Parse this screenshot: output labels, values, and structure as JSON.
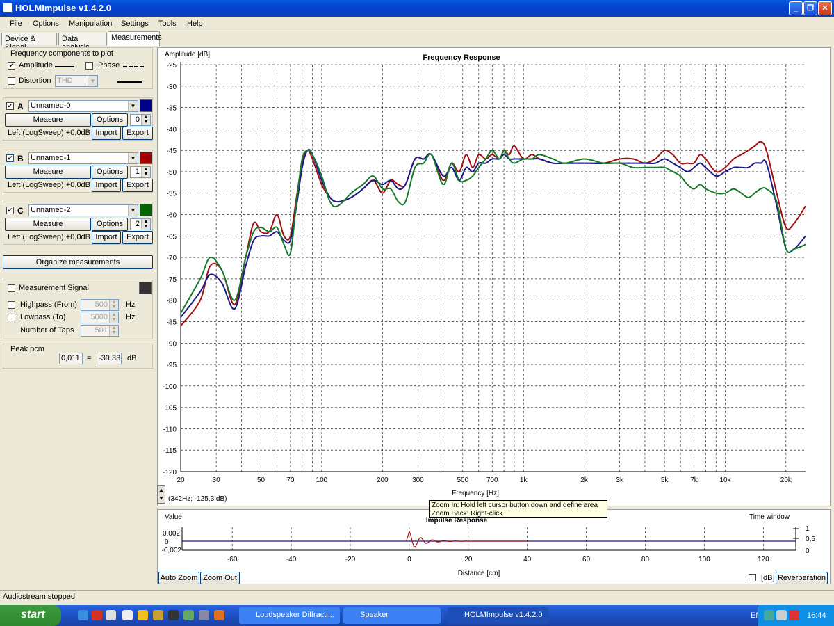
{
  "window": {
    "title": "HOLMImpulse  v1.4.2.0"
  },
  "menu": [
    "File",
    "Options",
    "Manipulation",
    "Settings",
    "Tools",
    "Help"
  ],
  "tabs": [
    "Device & Signal",
    "Data analysis",
    "Measurements"
  ],
  "freq_components": {
    "title": "Frequency components to plot",
    "amplitude_label": "Amplitude",
    "amplitude_checked": true,
    "phase_label": "Phase",
    "phase_checked": false,
    "distortion_label": "Distortion",
    "distortion_checked": false,
    "distortion_value": "THD"
  },
  "measurements": [
    {
      "letter": "A",
      "name": "Unnamed-0",
      "color": "#00008b",
      "checked": true,
      "measure_label": "Measure",
      "options_label": "Options",
      "spin": "0",
      "info": "Left (LogSweep) +0,0dB",
      "import_label": "Import",
      "export_label": "Export"
    },
    {
      "letter": "B",
      "name": "Unnamed-1",
      "color": "#a00000",
      "checked": true,
      "measure_label": "Measure",
      "options_label": "Options",
      "spin": "1",
      "info": "Left (LogSweep) +0,0dB",
      "import_label": "Import",
      "export_label": "Export"
    },
    {
      "letter": "C",
      "name": "Unnamed-2",
      "color": "#006400",
      "checked": true,
      "measure_label": "Measure",
      "options_label": "Options",
      "spin": "2",
      "info": "Left (LogSweep) +0,0dB",
      "import_label": "Import",
      "export_label": "Export"
    }
  ],
  "organize_label": "Organize measurements",
  "signal": {
    "measurement_signal_label": "Measurement Signal",
    "measurement_signal_checked": false,
    "signal_color": "#333333",
    "highpass_label": "Highpass (From)",
    "highpass_value": "500",
    "lowpass_label": "Lowpass (To)",
    "lowpass_value": "5000",
    "hz": "Hz",
    "taps_label": "Number of Taps",
    "taps_value": "501"
  },
  "peak": {
    "title": "Peak pcm",
    "value": "0,011",
    "eq": "=",
    "db_value": "-39,33",
    "unit": "dB"
  },
  "chart_data": {
    "type": "line",
    "title": "Frequency Response",
    "ylabel": "Amplitude [dB]",
    "xlabel": "Frequency [Hz]",
    "xscale": "log",
    "xlim": [
      20,
      25000
    ],
    "ylim": [
      -120,
      -25
    ],
    "yticks": [
      "-25",
      "-30",
      "-35",
      "-40",
      "-45",
      "-50",
      "-55",
      "-60",
      "-65",
      "-70",
      "-75",
      "-80",
      "-85",
      "-90",
      "-95",
      "-100",
      "-105",
      "-110",
      "-115",
      "-120"
    ],
    "xticks": [
      {
        "v": 20,
        "l": "20"
      },
      {
        "v": 30,
        "l": "30"
      },
      {
        "v": 50,
        "l": "50"
      },
      {
        "v": 70,
        "l": "70"
      },
      {
        "v": 100,
        "l": "100"
      },
      {
        "v": 200,
        "l": "200"
      },
      {
        "v": 300,
        "l": "300"
      },
      {
        "v": 500,
        "l": "500"
      },
      {
        "v": 700,
        "l": "700"
      },
      {
        "v": 1000,
        "l": "1k"
      },
      {
        "v": 2000,
        "l": "2k"
      },
      {
        "v": 3000,
        "l": "3k"
      },
      {
        "v": 5000,
        "l": "5k"
      },
      {
        "v": 7000,
        "l": "7k"
      },
      {
        "v": 10000,
        "l": "10k"
      },
      {
        "v": 20000,
        "l": "20k"
      }
    ],
    "grid": true,
    "series": [
      {
        "color": "#a01010",
        "x": [
          20,
          25,
          28,
          32,
          37,
          42,
          46,
          50,
          55,
          60,
          65,
          70,
          75,
          80,
          85,
          90,
          100,
          110,
          120,
          140,
          160,
          180,
          200,
          220,
          240,
          260,
          290,
          320,
          350,
          400,
          440,
          480,
          520,
          560,
          600,
          650,
          700,
          760,
          800,
          850,
          900,
          1000,
          1100,
          1200,
          1400,
          1600,
          2000,
          2500,
          3000,
          3500,
          4000,
          4500,
          5000,
          5500,
          6000,
          6500,
          7000,
          7500,
          8000,
          9000,
          10000,
          11000,
          12000,
          13000,
          14000,
          15000,
          16000,
          18000,
          20000,
          22000,
          25000
        ],
        "y": [
          -86,
          -80,
          -72,
          -73,
          -81,
          -70,
          -62,
          -64,
          -64,
          -60,
          -65,
          -65,
          -56,
          -48,
          -45,
          -47,
          -53,
          -56,
          -57,
          -56,
          -54,
          -52,
          -55,
          -52,
          -53,
          -53,
          -47,
          -47,
          -46,
          -52,
          -48,
          -50,
          -46,
          -49,
          -46,
          -47,
          -46,
          -47,
          -45,
          -46,
          -44,
          -47,
          -46,
          -47,
          -48,
          -48,
          -48,
          -48,
          -47,
          -47,
          -48,
          -47,
          -45,
          -46,
          -48,
          -48,
          -48,
          -46,
          -47,
          -50,
          -49,
          -47,
          -46,
          -45,
          -44,
          -43,
          -45,
          -55,
          -63,
          -62,
          -58
        ]
      },
      {
        "color": "#1a1a8c",
        "x": [
          20,
          25,
          28,
          32,
          37,
          42,
          46,
          50,
          55,
          60,
          65,
          70,
          75,
          80,
          85,
          90,
          100,
          110,
          120,
          140,
          160,
          180,
          200,
          220,
          240,
          260,
          290,
          320,
          350,
          400,
          440,
          480,
          520,
          560,
          600,
          650,
          700,
          760,
          800,
          850,
          900,
          1000,
          1100,
          1200,
          1400,
          1600,
          2000,
          2500,
          3000,
          3500,
          4000,
          4500,
          5000,
          5500,
          6000,
          6500,
          7000,
          7500,
          8000,
          9000,
          10000,
          11000,
          12000,
          13000,
          14000,
          15000,
          16000,
          18000,
          20000,
          22000,
          25000
        ],
        "y": [
          -84,
          -78,
          -74,
          -76,
          -82,
          -72,
          -66,
          -65,
          -65,
          -64,
          -66,
          -66,
          -58,
          -49,
          -45,
          -46,
          -52,
          -56,
          -57,
          -56,
          -54,
          -52,
          -53,
          -52,
          -54,
          -53,
          -47,
          -47,
          -46,
          -51,
          -49,
          -52,
          -49,
          -50,
          -48,
          -48,
          -47,
          -47,
          -46,
          -47,
          -47,
          -47,
          -47,
          -47,
          -48,
          -48,
          -48,
          -48,
          -48,
          -48,
          -48,
          -48,
          -47,
          -48,
          -49,
          -50,
          -49,
          -48,
          -49,
          -51,
          -50,
          -49,
          -49,
          -49,
          -48,
          -48,
          -48,
          -58,
          -68,
          -68,
          -65
        ]
      },
      {
        "color": "#157a2c",
        "x": [
          20,
          25,
          28,
          32,
          37,
          42,
          46,
          50,
          55,
          60,
          65,
          70,
          75,
          80,
          85,
          90,
          100,
          110,
          120,
          140,
          160,
          180,
          200,
          220,
          240,
          260,
          290,
          320,
          350,
          400,
          440,
          480,
          520,
          560,
          600,
          650,
          700,
          760,
          800,
          850,
          900,
          1000,
          1100,
          1200,
          1400,
          1600,
          2000,
          2500,
          3000,
          3500,
          4000,
          4500,
          5000,
          5500,
          6000,
          6500,
          7000,
          7500,
          8000,
          9000,
          10000,
          11000,
          12000,
          13000,
          14000,
          15000,
          16000,
          18000,
          20000,
          22000,
          25000
        ],
        "y": [
          -83,
          -75,
          -70,
          -73,
          -80,
          -70,
          -64,
          -63,
          -64,
          -63,
          -67,
          -69,
          -57,
          -47,
          -45,
          -46,
          -51,
          -57,
          -58,
          -55,
          -53,
          -51,
          -54,
          -54,
          -57,
          -57,
          -49,
          -48,
          -46,
          -53,
          -48,
          -52,
          -52,
          -51,
          -49,
          -47,
          -45,
          -47,
          -45,
          -47,
          -48,
          -47,
          -47,
          -46,
          -47,
          -48,
          -47,
          -48,
          -48,
          -49,
          -49,
          -49,
          -49,
          -50,
          -51,
          -53,
          -54,
          -53,
          -54,
          -55,
          -55,
          -54,
          -55,
          -56,
          -55,
          -54,
          -54,
          -57,
          -68,
          -68,
          -67
        ]
      }
    ]
  },
  "cursor_readout": "(342Hz; -125,3 dB)",
  "impulse": {
    "title": "Impulse Response",
    "value_label": "Value",
    "time_window_label": "Time window",
    "yticks": [
      "0,002",
      "0",
      "-0,002"
    ],
    "right_ticks": [
      "1",
      "0,5",
      "0"
    ],
    "xticks": [
      "-60",
      "-40",
      "-20",
      "0",
      "20",
      "40",
      "60",
      "80",
      "100",
      "120"
    ],
    "xlabel": "Distance [cm]",
    "auto_zoom_label": "Auto Zoom",
    "zoom_out_label": "Zoom Out",
    "db_label": "[dB]",
    "reverberation_label": "Reverberation"
  },
  "tooltip": {
    "line1": "Zoom In:   Hold left cursor button down and define area",
    "line2": "Zoom Back: Right-click"
  },
  "status": "Audiostream stopped",
  "taskbar": {
    "start_label": "start",
    "tasks": [
      "Loudspeaker Diffracti...",
      "Speaker",
      "HOLMImpulse  v1.4.2.0"
    ],
    "lang": "EN",
    "clock": "16:44"
  }
}
